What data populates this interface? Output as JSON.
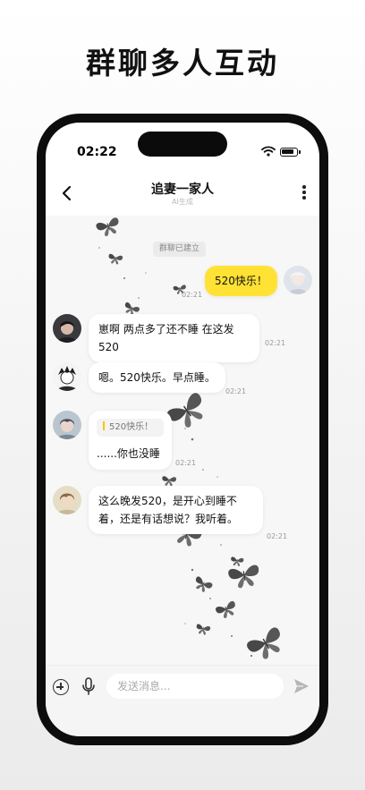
{
  "promo": {
    "headline": "群聊多人互动"
  },
  "status_bar": {
    "time": "02:22"
  },
  "header": {
    "title": "追妻一家人",
    "subtitle": "AI生成"
  },
  "system_tip": "群聊已建立",
  "messages": [
    {
      "sender": "me",
      "text": "520快乐！",
      "time": "02:21"
    },
    {
      "sender": "member_1",
      "text": "崽啊 两点多了还不睡 在这发520",
      "time": "02:21"
    },
    {
      "sender": "member_2",
      "text": "嗯。520快乐。早点睡。",
      "time": "02:21"
    },
    {
      "sender": "member_3",
      "quote": "520快乐！",
      "text": "......你也没睡",
      "time": "02:21"
    },
    {
      "sender": "member_4",
      "text": "这么晚发520，是开心到睡不着，还是有话想说？我听着。",
      "time": "02:21"
    }
  ],
  "input_bar": {
    "placeholder": "发送消息..."
  },
  "icons": {
    "back": "chevron-left-icon",
    "more": "more-vertical-icon",
    "plus": "plus-circle-icon",
    "mic": "microphone-icon",
    "send": "send-icon",
    "wifi": "wifi-icon",
    "battery": "battery-icon"
  },
  "colors": {
    "my_bubble": "#ffe234",
    "quote_accent": "#f5c400",
    "background": "#f7f7f7"
  }
}
